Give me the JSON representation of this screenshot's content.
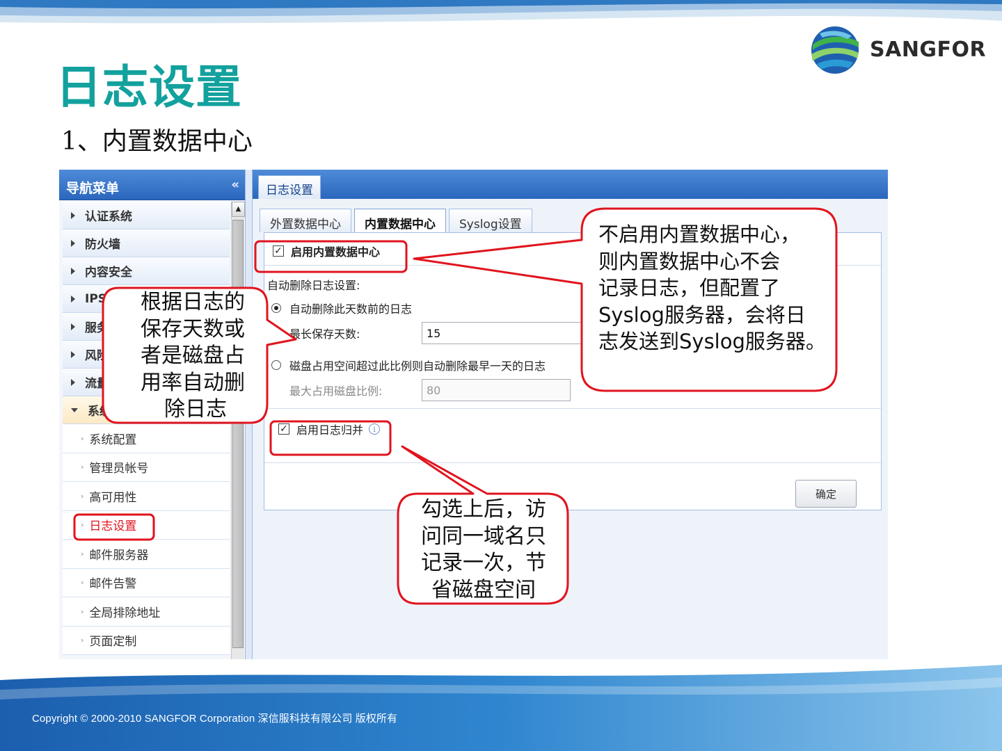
{
  "slide": {
    "title": "日志设置",
    "subtitle": "1、内置数据中心",
    "logo_text": "SANGFOR",
    "footer": "Copyright © 2000-2010 SANGFOR Corporation  深信服科技有限公司   版权所有"
  },
  "nav": {
    "header": "导航菜单",
    "collapse_glyph": "«",
    "items": [
      {
        "label": "认证系统"
      },
      {
        "label": "防火墙"
      },
      {
        "label": "内容安全"
      },
      {
        "label": "IPS"
      },
      {
        "label": "服务器保"
      },
      {
        "label": "风险分析"
      },
      {
        "label": "流量管理"
      },
      {
        "label": "系统"
      }
    ],
    "sub_items": [
      {
        "label": "系统配置"
      },
      {
        "label": "管理员帐号"
      },
      {
        "label": "高可用性"
      },
      {
        "label": "日志设置"
      },
      {
        "label": "邮件服务器"
      },
      {
        "label": "邮件告警"
      },
      {
        "label": "全局排除地址"
      },
      {
        "label": "页面定制"
      }
    ],
    "selected": "日志设置"
  },
  "panel": {
    "tab": "日志设置",
    "subtabs": [
      "外置数据中心",
      "内置数据中心",
      "Syslog设置"
    ],
    "active_subtab": "内置数据中心",
    "enable_builtin": {
      "label": "启用内置数据中心",
      "checked": true
    },
    "auto_delete_title": "自动删除日志设置:",
    "option_days": {
      "label": "自动删除此天数前的日志",
      "selected": true
    },
    "max_days": {
      "label": "最长保存天数:",
      "value": "15"
    },
    "option_disk": {
      "label": "磁盘占用空间超过此比例则自动删除最早一天的日志",
      "selected": false
    },
    "max_disk": {
      "label": "最大占用磁盘比例:",
      "value": "80"
    },
    "merge_logs": {
      "label": "启用日志归并",
      "checked": true
    },
    "ok_button": "确定"
  },
  "annotations": {
    "left": [
      "根据日志的",
      "保存天数或",
      "者是磁盘占",
      "用率自动删",
      "除日志"
    ],
    "right": [
      "不启用内置数据中心，",
      "则内置数据中心不会",
      "记录日志，但配置了",
      "Syslog服务器，会将日",
      "志发送到Syslog服务器。"
    ],
    "bottom": [
      "勾选上后，访",
      "问同一域名只",
      "记录一次，节",
      "省磁盘空间"
    ]
  },
  "colors": {
    "title": "#13a19e",
    "annotation_stroke": "#e0141e",
    "nav_header": "#2a67bd",
    "selected_item": "#e0141e"
  }
}
